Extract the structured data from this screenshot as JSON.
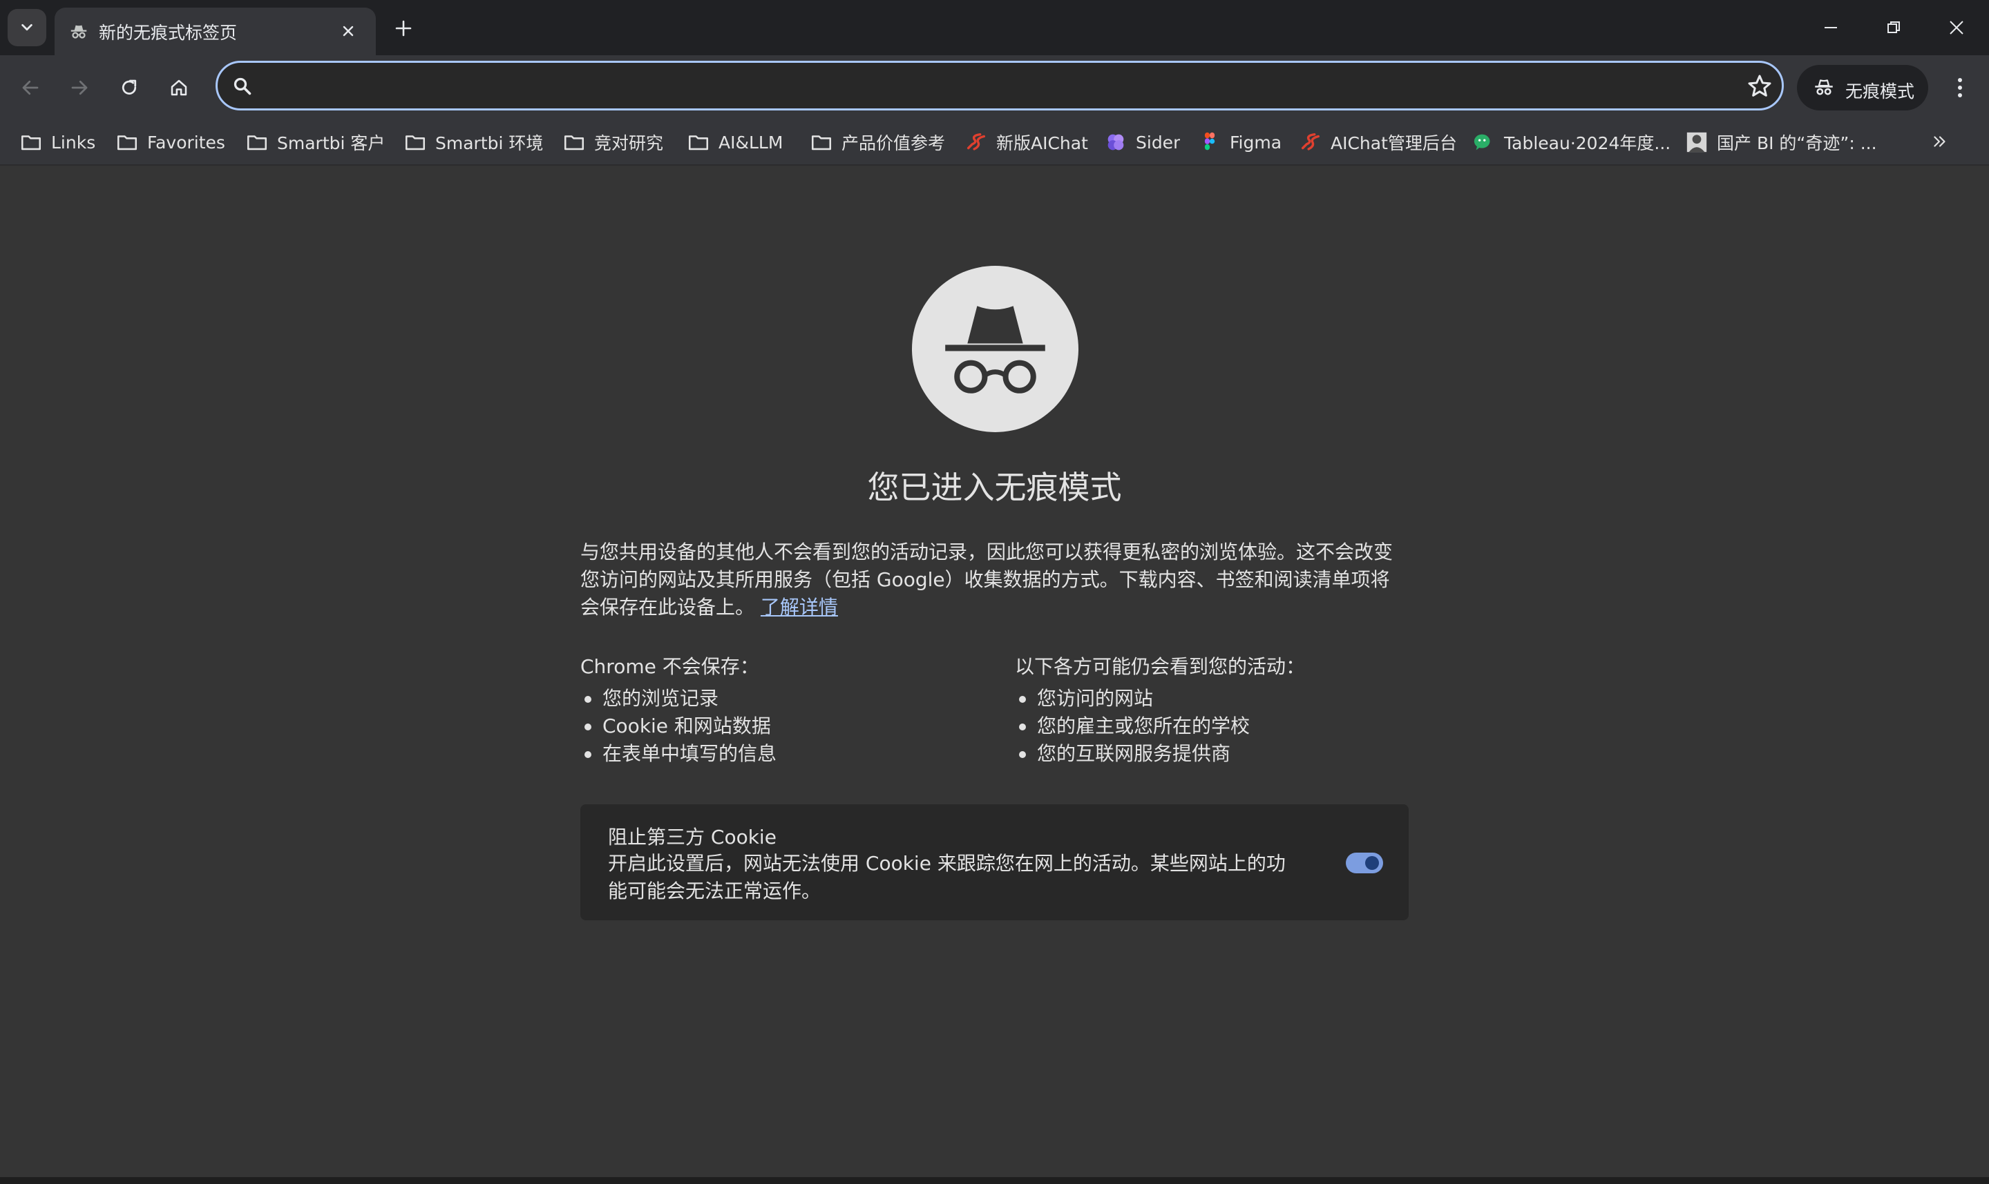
{
  "window": {
    "tab_title": "新的无痕式标签页"
  },
  "toolbar": {
    "omnibox_value": "",
    "incognito_label": "无痕模式"
  },
  "bookmarks": [
    {
      "label": "Links",
      "icon": "folder-icon"
    },
    {
      "label": "Favorites",
      "icon": "folder-icon"
    },
    {
      "label": "Smartbi 客户",
      "icon": "folder-icon"
    },
    {
      "label": "Smartbi 环境",
      "icon": "folder-icon"
    },
    {
      "label": "竞对研究",
      "icon": "folder-icon"
    },
    {
      "label": "AI&LLM",
      "icon": "folder-icon"
    },
    {
      "label": "产品价值参考",
      "icon": "folder-icon"
    },
    {
      "label": "新版AIChat",
      "icon": "smartbi-logo-icon"
    },
    {
      "label": "Sider",
      "icon": "sider-logo-icon"
    },
    {
      "label": "Figma",
      "icon": "figma-logo-icon"
    },
    {
      "label": "AIChat管理后台",
      "icon": "smartbi-logo-icon"
    },
    {
      "label": "Tableau·2024年度...",
      "icon": "wechat-logo-icon"
    },
    {
      "label": "国产 BI 的“奇迹”: ...",
      "icon": "avatar-icon"
    }
  ],
  "main": {
    "headline": "您已进入无痕模式",
    "description": "与您共用设备的其他人不会看到您的活动记录，因此您可以获得更私密的浏览体验。这不会改变您访问的网站及其所用服务（包括 Google）收集数据的方式。下载内容、书签和阅读清单项将会保存在此设备上。",
    "learn_more": "了解详情",
    "not_saved": {
      "title": "Chrome 不会保存：",
      "items": [
        "您的浏览记录",
        "Cookie 和网站数据",
        "在表单中填写的信息"
      ]
    },
    "may_see": {
      "title": "以下各方可能仍会看到您的活动：",
      "items": [
        "您访问的网站",
        "您的雇主或您所在的学校",
        "您的互联网服务提供商"
      ]
    },
    "cookie": {
      "title": "阻止第三方 Cookie",
      "description": "开启此设置后，网站无法使用 Cookie 来跟踪您在网上的活动。某些网站上的功能可能会无法正常运作。",
      "enabled": true
    }
  },
  "colors": {
    "accent": "#a8c7fa",
    "page_bg": "#353535",
    "titlebar_bg": "#202124",
    "card_bg": "#282828"
  }
}
